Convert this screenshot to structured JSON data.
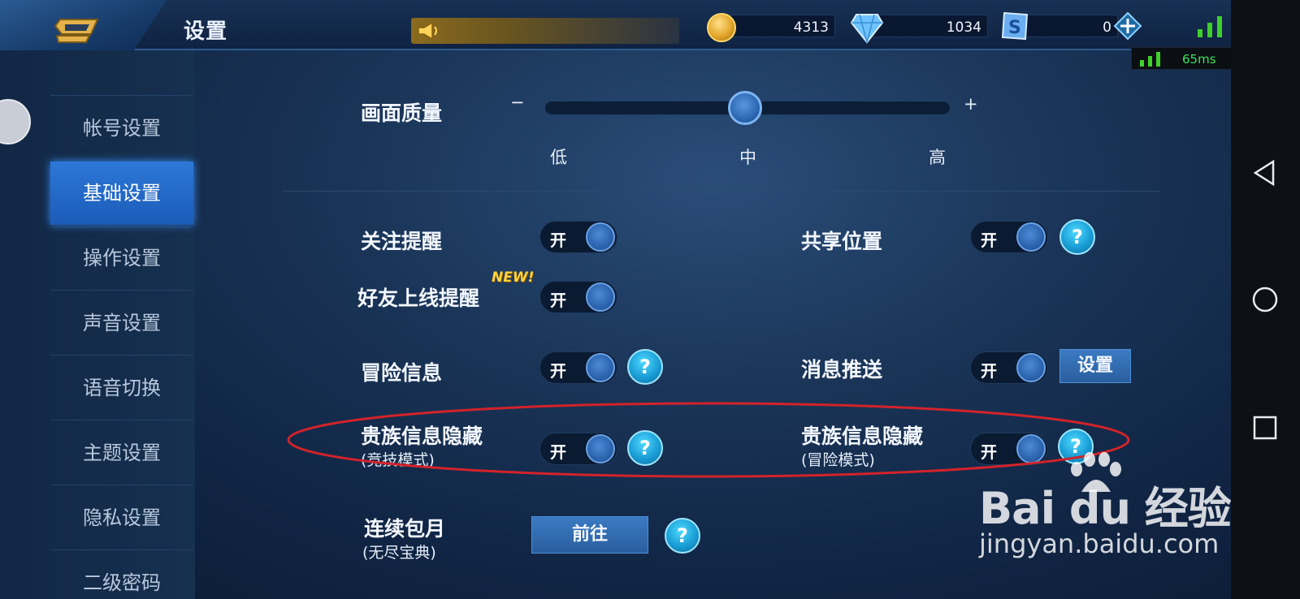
{
  "header": {
    "title": "设置",
    "gold_value": "4313",
    "diamond_value": "1034",
    "coupon_value": "0",
    "ping": "65ms"
  },
  "sidebar": {
    "items": [
      {
        "label": "帐号设置",
        "active": false
      },
      {
        "label": "基础设置",
        "active": true
      },
      {
        "label": "操作设置",
        "active": false
      },
      {
        "label": "声音设置",
        "active": false
      },
      {
        "label": "语音切换",
        "active": false
      },
      {
        "label": "主题设置",
        "active": false
      },
      {
        "label": "隐私设置",
        "active": false
      },
      {
        "label": "二级密码",
        "active": false
      }
    ]
  },
  "quality": {
    "label": "画面质量",
    "minus": "−",
    "plus": "+",
    "levels": [
      "低",
      "中",
      "高"
    ],
    "selected": "中"
  },
  "settings": {
    "follow_remind": {
      "label": "关注提醒",
      "toggle": "开"
    },
    "share_location": {
      "label": "共享位置",
      "toggle": "开",
      "help": "?"
    },
    "friend_online": {
      "label": "好友上线提醒",
      "badge": "NEW!",
      "toggle": "开"
    },
    "adventure_info": {
      "label": "冒险信息",
      "toggle": "开",
      "help": "?"
    },
    "push_message": {
      "label": "消息推送",
      "toggle": "开",
      "button": "设置"
    },
    "noble_hide_pvp": {
      "label": "贵族信息隐藏",
      "sub": "(竞技模式)",
      "toggle": "开",
      "help": "?"
    },
    "noble_hide_adv": {
      "label": "贵族信息隐藏",
      "sub": "(冒险模式)",
      "toggle": "开",
      "help": "?"
    },
    "monthly": {
      "label": "连续包月",
      "sub": "(无尽宝典)",
      "button": "前往",
      "help": "?"
    }
  },
  "watermark": {
    "logo": "Bai du 经验",
    "url": "jingyan.baidu.com"
  },
  "colors": {
    "accent_blue": "#2d78d8",
    "help_cyan": "#1a9ed6",
    "highlight_red": "#d2232a",
    "ping_green": "#3fe05a"
  },
  "icons": [
    "back-arrow-icon",
    "megaphone-icon",
    "gold-coin-icon",
    "diamond-icon",
    "coupon-icon",
    "plus-icon",
    "signal-icon",
    "battery-icon",
    "android-back-icon",
    "android-home-icon",
    "android-recents-icon",
    "question-icon"
  ]
}
